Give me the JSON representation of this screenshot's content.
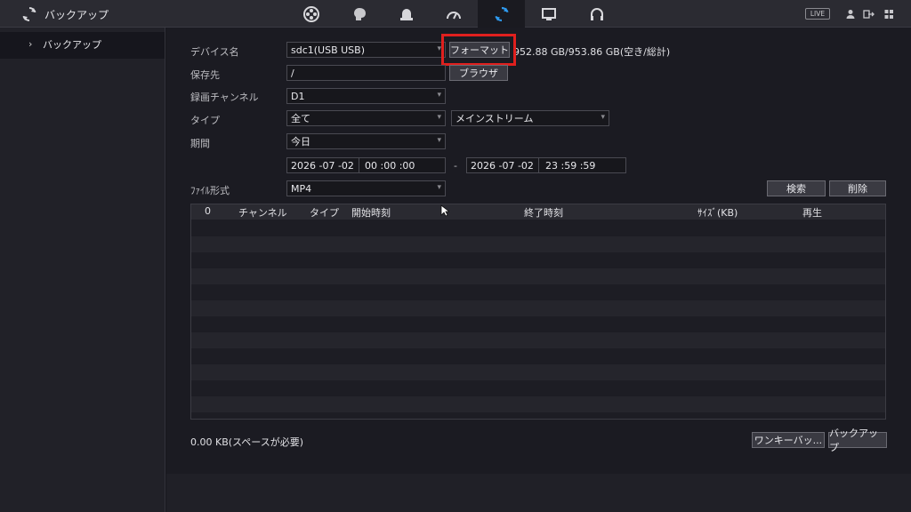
{
  "header": {
    "title": "バックアップ",
    "nav_icons": [
      "film-reel-icon",
      "brain-icon",
      "camera-dome-icon",
      "gauge-icon",
      "backup-sync-icon",
      "monitor-icon",
      "headset-icon"
    ],
    "active_nav": "backup-sync-icon",
    "live_badge": "LIVE"
  },
  "sidebar": {
    "items": [
      {
        "label": "バックアップ"
      }
    ]
  },
  "form": {
    "device": {
      "label": "デバイス名",
      "value": "sdc1(USB USB)",
      "format_button": "フォーマット",
      "capacity": "952.88 GB/953.86 GB(空き/総計)"
    },
    "save_to": {
      "label": "保存先",
      "value": "/",
      "browse_button": "ブラウザ"
    },
    "channel": {
      "label": "録画チャンネル",
      "value": "D1"
    },
    "type": {
      "label": "タイプ",
      "value": "全て",
      "stream": "メインストリーム"
    },
    "period": {
      "label": "期間",
      "value": "今日"
    },
    "range": {
      "start_date": "2026 -07 -02",
      "start_time": "00 :00 :00",
      "sep": "-",
      "end_date": "2026 -07 -02",
      "end_time": "23 :59 :59"
    },
    "file_format": {
      "label": "ﾌｧｲﾙ形式",
      "value": "MP4"
    },
    "search_button": "検索",
    "delete_button": "削除"
  },
  "table": {
    "columns": [
      "0",
      "チャンネル",
      "タイプ",
      "開始時刻",
      "終了時刻",
      "ｻｲｽﾞ(KB)",
      "再生"
    ],
    "rows": []
  },
  "bottom": {
    "status": "0.00 KB(スペースが必要)",
    "oneclick_button": "ワンキーバッ...",
    "backup_button": "バックアップ"
  },
  "colors": {
    "accent": "#2f9bf0",
    "highlight": "#e0201e",
    "background": "#16161d"
  }
}
